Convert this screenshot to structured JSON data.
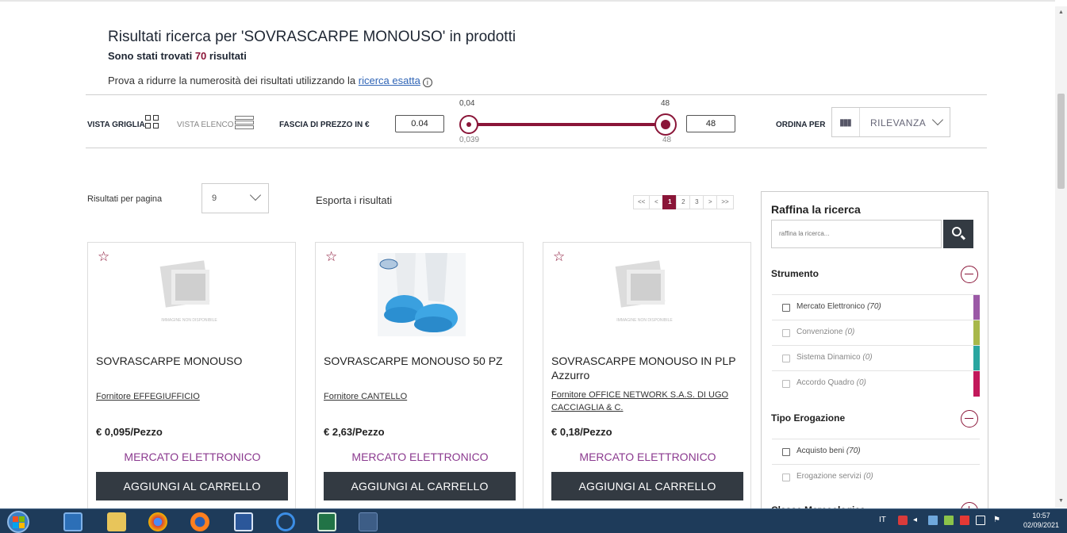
{
  "search": {
    "title": "Risultati ricerca per 'SOVRASCARPE MONOUSO' in prodotti",
    "found_prefix": "Sono stati trovati",
    "found_count": "70",
    "found_suffix": "risultati",
    "hint_text": "Prova a ridurre la numerosità dei risultati utilizzando la",
    "hint_link": "ricerca esatta",
    "hint_info": "i"
  },
  "toolbar": {
    "grid_view_label": "VISTA GRIGLIA",
    "list_view_label": "VISTA ELENCO",
    "price_range_label": "FASCIA DI PREZZO IN €",
    "price_min_value": "0.04",
    "price_max_value": "48",
    "slider_min_top": "0,04",
    "slider_max_top": "48",
    "slider_min_bottom": "0,039",
    "slider_max_bottom": "48",
    "sort_label": "ORDINA PER",
    "sort_value": "RILEVANZA"
  },
  "results": {
    "per_page_label": "Risultati per pagina",
    "per_page_value": "9",
    "export_label": "Esporta i risultati",
    "pagination": [
      "<<",
      "<",
      "1",
      "2",
      "3",
      ">",
      ">>"
    ],
    "current_page": "1"
  },
  "products": [
    {
      "name": "SOVRASCARPE MONOUSO",
      "supplier": "Fornitore EFFEGIUFFICIO",
      "price": "€ 0,095/Pezzo",
      "market": "MERCATO ELETTRONICO",
      "button": "AGGIUNGI AL CARRELLO",
      "image_placeholder": "IMMAGINE NON DISPONIBILE"
    },
    {
      "name": "SOVRASCARPE MONOUSO 50 PZ",
      "supplier": "Fornitore CANTELLO",
      "price": "€ 2,63/Pezzo",
      "market": "MERCATO ELETTRONICO",
      "button": "AGGIUNGI AL CARRELLO",
      "image_placeholder": ""
    },
    {
      "name": "SOVRASCARPE MONOUSO IN PLP Azzurro",
      "supplier": "Fornitore OFFICE NETWORK S.A.S. DI UGO CACCIAGLIA & C.",
      "price": "€ 0,18/Pezzo",
      "market": "MERCATO ELETTRONICO",
      "button": "AGGIUNGI AL CARRELLO",
      "image_placeholder": "IMMAGINE NON DISPONIBILE"
    }
  ],
  "refine": {
    "title": "Raffina la ricerca",
    "placeholder": "raffina la ricerca...",
    "sections": [
      {
        "title": "Strumento",
        "options": [
          {
            "label": "Mercato Elettronico",
            "count": "(70)",
            "color": "#9b59a6"
          },
          {
            "label": "Convenzione",
            "count": "(0)",
            "color": "#a8b84a"
          },
          {
            "label": "Sistema Dinamico",
            "count": "(0)",
            "color": "#2aa6a0"
          },
          {
            "label": "Accordo Quadro",
            "count": "(0)",
            "color": "#c2185b"
          }
        ]
      },
      {
        "title": "Tipo Erogazione",
        "options": [
          {
            "label": "Acquisto beni",
            "count": "(70)"
          },
          {
            "label": "Erogazione servizi",
            "count": "(0)"
          }
        ]
      },
      {
        "title": "Classe Merceologica",
        "options": []
      }
    ]
  },
  "taskbar": {
    "lang": "IT",
    "time": "10:57",
    "date": "02/09/2021"
  },
  "colors": {
    "accent": "#8a1538",
    "market_text": "#8b3a8f",
    "button_dark": "#333a42",
    "link": "#2f64b6"
  }
}
